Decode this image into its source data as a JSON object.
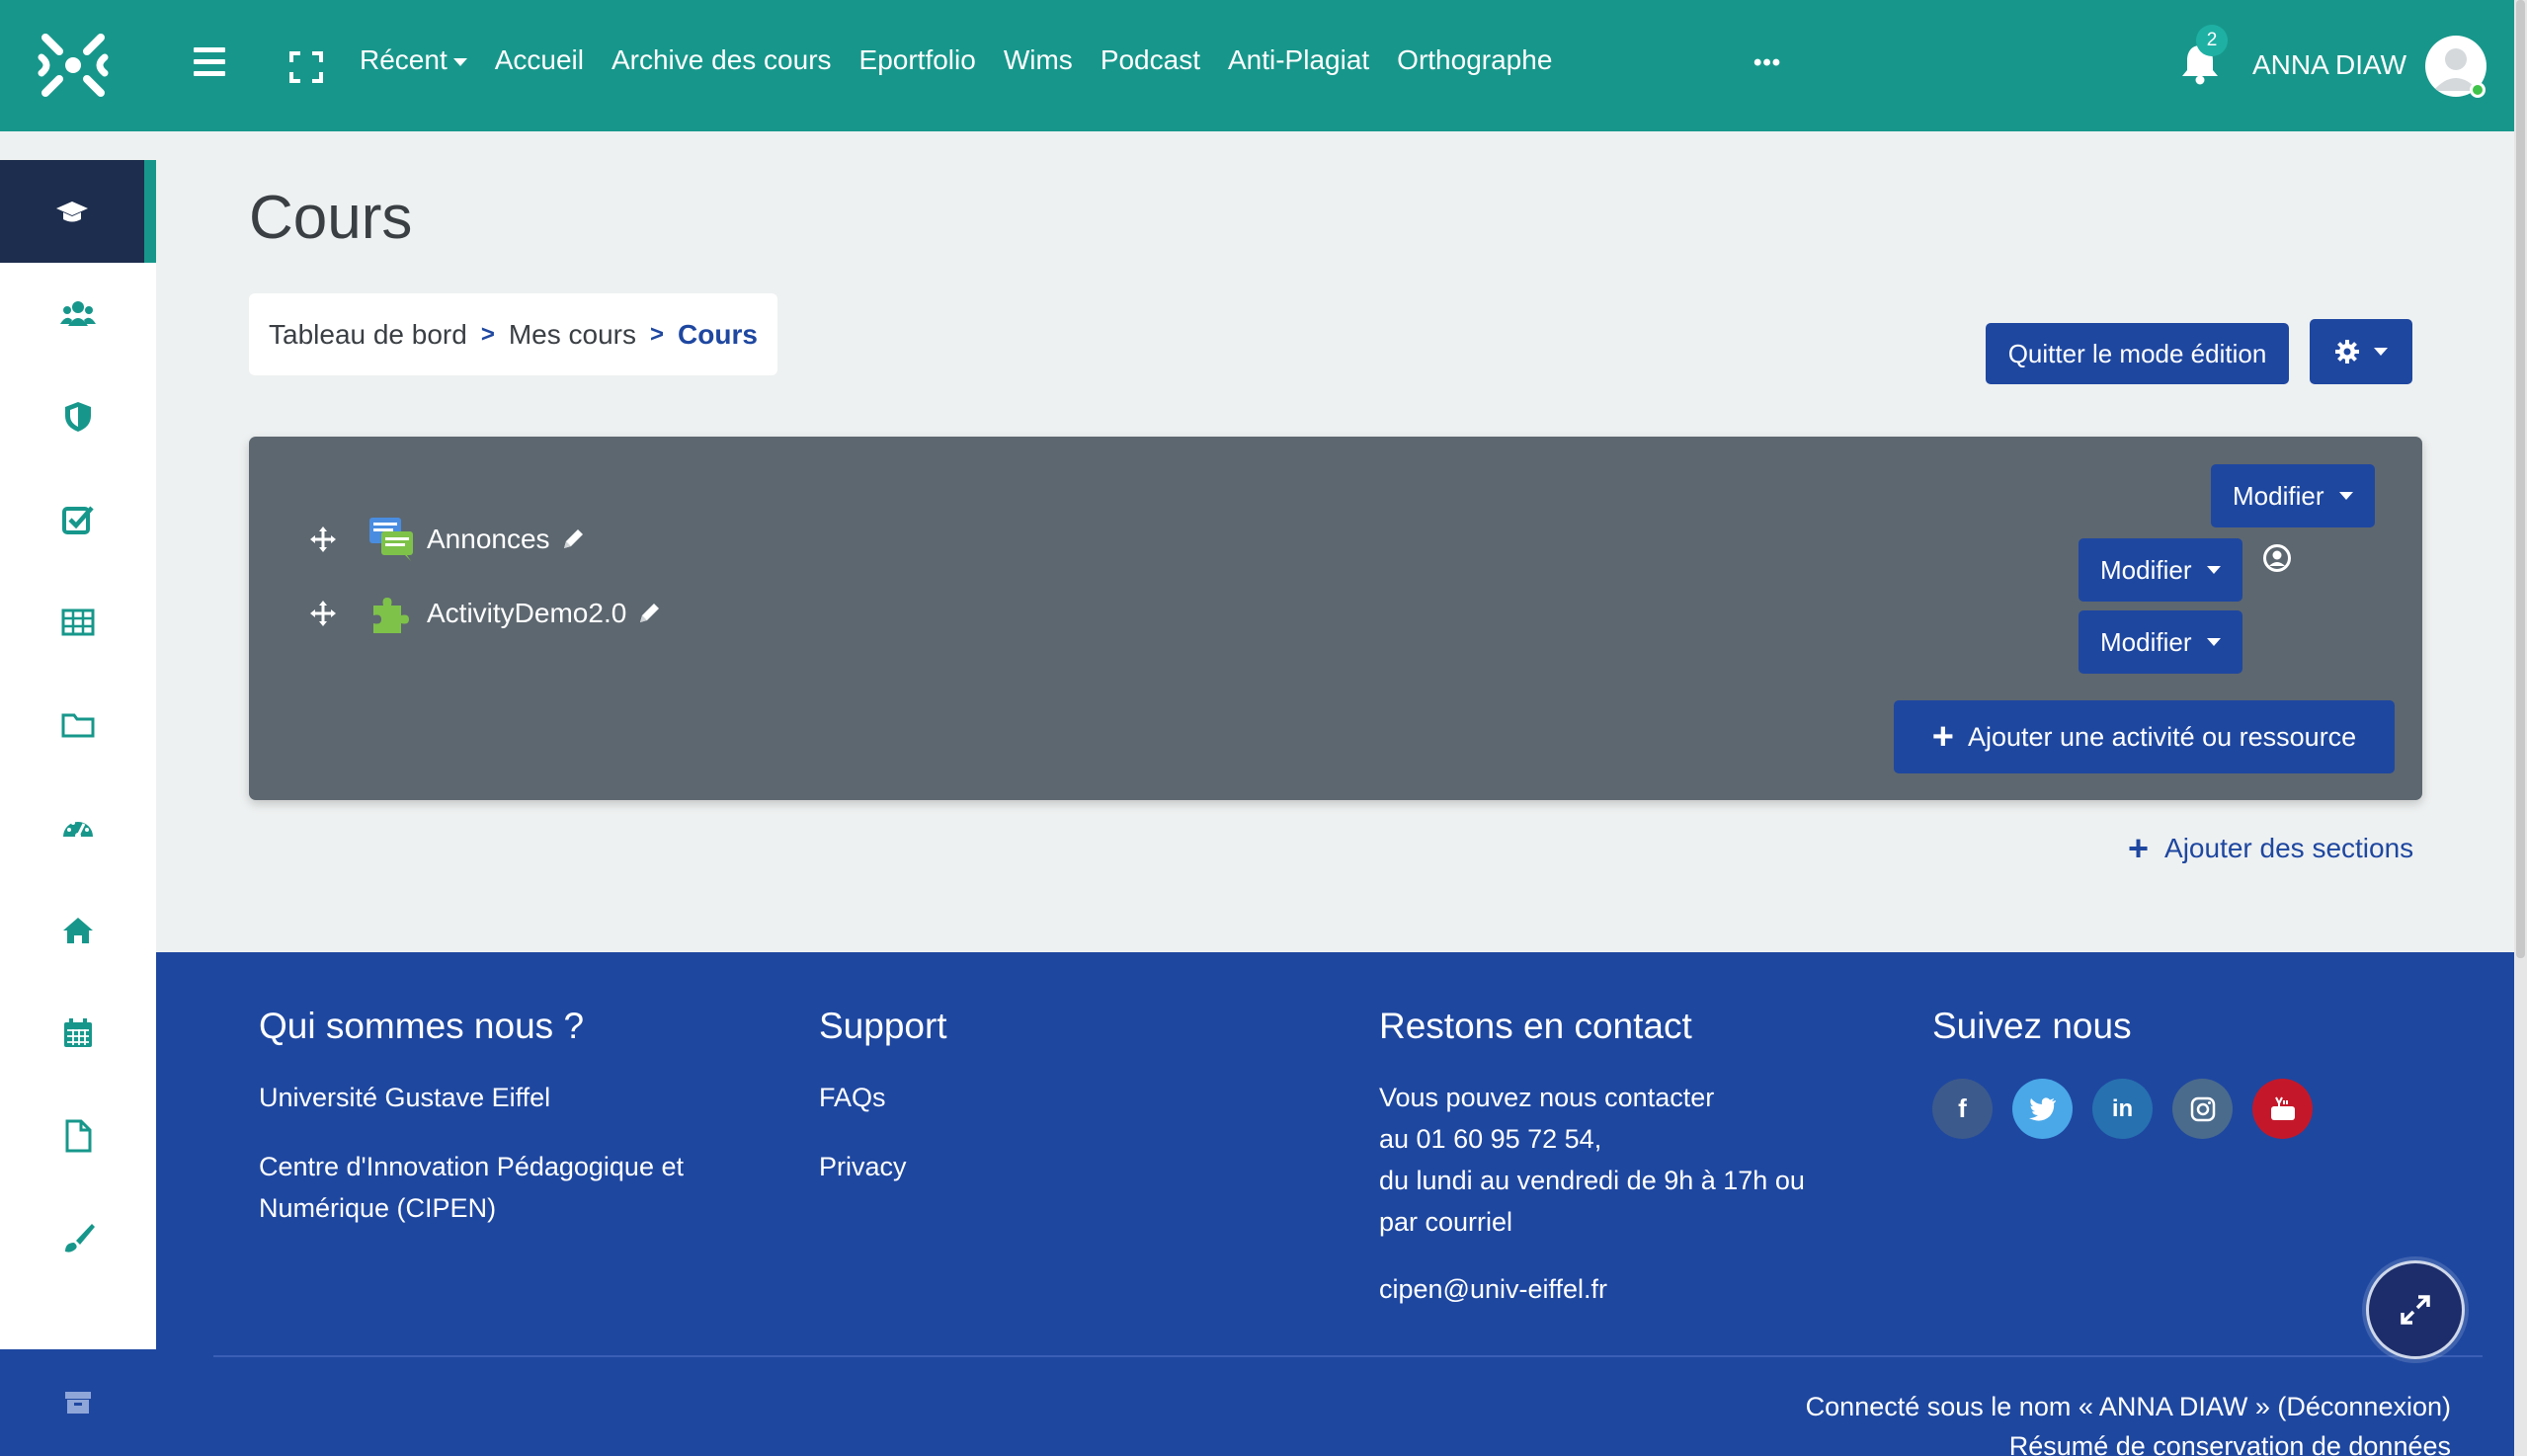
{
  "navbar": {
    "recent_label": "Récent",
    "links": [
      "Accueil",
      "Archive des cours",
      "Eportfolio",
      "Wims",
      "Podcast",
      "Anti-Plagiat",
      "Orthographe"
    ],
    "more_label": "•••",
    "notification_count": "2",
    "username": "ANNA DIAW",
    "color": "#17978b"
  },
  "sidebar": {
    "items": [
      {
        "icon": "graduation-cap-icon",
        "active": true
      },
      {
        "icon": "users-icon"
      },
      {
        "icon": "shield-icon"
      },
      {
        "icon": "checkbox-icon"
      },
      {
        "icon": "table-icon"
      },
      {
        "icon": "folder-icon"
      },
      {
        "icon": "dashboard-icon"
      },
      {
        "icon": "home-icon"
      },
      {
        "icon": "calendar-icon"
      },
      {
        "icon": "file-icon"
      },
      {
        "icon": "brush-icon"
      }
    ],
    "bottom_icon": "archive-icon"
  },
  "page": {
    "title": "Cours",
    "breadcrumb": {
      "items": [
        "Tableau de bord",
        "Mes cours",
        "Cours"
      ],
      "separator": ">"
    },
    "quit_edit_label": "Quitter le mode édition"
  },
  "section": {
    "modifier_label": "Modifier",
    "activities": [
      {
        "name": "Annonces",
        "icon": "forum-icon"
      },
      {
        "name": "ActivityDemo2.0",
        "icon": "puzzle-icon"
      }
    ],
    "add_activity_label": "Ajouter une activité ou ressource",
    "add_sections_label": "Ajouter des sections"
  },
  "footer": {
    "about": {
      "heading": "Qui sommes nous ?",
      "lines": [
        "Université Gustave Eiffel",
        "Centre d'Innovation Pédagogique et",
        "Numérique (CIPEN)"
      ]
    },
    "support": {
      "heading": "Support",
      "links": [
        "FAQs",
        "Privacy"
      ]
    },
    "contact": {
      "heading": "Restons en contact",
      "lines": [
        "Vous pouvez nous contacter",
        "au 01 60 95 72 54,",
        "du lundi au vendredi de 9h à 17h ou",
        "par courriel"
      ],
      "email": "cipen@univ-eiffel.fr"
    },
    "follow": {
      "heading": "Suivez nous",
      "networks": [
        {
          "name": "facebook-icon",
          "glyph": "f",
          "color": "#3c5a8c"
        },
        {
          "name": "twitter-icon",
          "glyph": "t",
          "color": "#4aa8e8"
        },
        {
          "name": "linkedin-icon",
          "glyph": "in",
          "color": "#2771b0"
        },
        {
          "name": "instagram-icon",
          "glyph": "◎",
          "color": "#4a6b8c"
        },
        {
          "name": "youtube-icon",
          "glyph": "You",
          "color": "#c4182a"
        }
      ]
    },
    "logged_in_text": "Connecté sous le nom « ANNA DIAW » (Déconnexion)",
    "data_retention_link": "Résumé de conservation de données"
  }
}
